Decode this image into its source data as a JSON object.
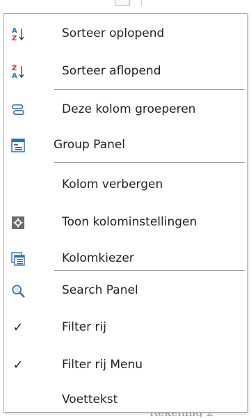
{
  "menu": {
    "items": [
      {
        "label": "Sorteer oplopend",
        "icon": "sort-ascending-icon"
      },
      {
        "label": "Sorteer aflopend",
        "icon": "sort-descending-icon"
      },
      {
        "label": "Deze kolom groeperen",
        "icon": "group-by-column-icon"
      },
      {
        "label": "Group Panel",
        "icon": "group-panel-icon"
      },
      {
        "label": "Kolom verbergen",
        "icon": ""
      },
      {
        "label": "Toon kolominstellingen",
        "icon": "column-settings-icon"
      },
      {
        "label": "Kolomkiezer",
        "icon": "column-chooser-icon"
      },
      {
        "label": "Search Panel",
        "icon": "search-icon"
      },
      {
        "label": "Filter rij",
        "icon": "check-icon"
      },
      {
        "label": "Filter rij Menu",
        "icon": "check-icon"
      },
      {
        "label": "Voettekst",
        "icon": ""
      }
    ],
    "sort_icon_letters": {
      "top_asc": "A",
      "bottom_asc": "Z",
      "top_desc": "Z",
      "bottom_desc": "A"
    },
    "check_glyph": "✓"
  },
  "colors": {
    "accent_blue": "#2b6fc4",
    "letter_red": "#c8202b",
    "icon_gray": "#6b6b6b",
    "separator": "#9e9e9e"
  },
  "background": {
    "bottom_text": "Rekening 2"
  }
}
